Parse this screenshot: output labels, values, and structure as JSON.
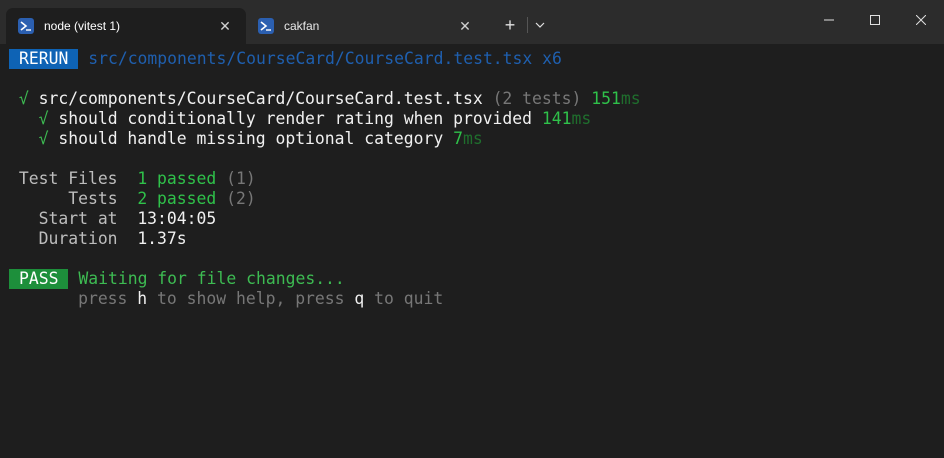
{
  "tabs": [
    {
      "title": "node (vitest 1)",
      "active": true,
      "icon": "powershell-icon"
    },
    {
      "title": "cakfan",
      "active": false,
      "icon": "powershell-icon"
    }
  ],
  "tabbar": {
    "new_tab": "+",
    "dropdown_icon": "chevron-down-icon"
  },
  "window": {
    "minimize_icon": "minimize-icon",
    "maximize_icon": "maximize-icon",
    "close_icon": "close-icon"
  },
  "terminal": {
    "rerun": {
      "badge": "RERUN",
      "file": "src/components/CourseCard/CourseCard.test.tsx",
      "count": "x6"
    },
    "suite": {
      "check": "√",
      "file": "src/components/CourseCard/CourseCard.test.tsx",
      "tests": "(2 tests)",
      "time": "151",
      "unit": "ms"
    },
    "tests": [
      {
        "check": "√",
        "name": "should conditionally render rating when provided",
        "time": "141",
        "unit": "ms"
      },
      {
        "check": "√",
        "name": "should handle missing optional category",
        "time": "7",
        "unit": "ms"
      }
    ],
    "summary": {
      "files_label": "Test Files",
      "files_value": "1 passed",
      "files_total": "(1)",
      "tests_label": "Tests",
      "tests_value": "2 passed",
      "tests_total": "(2)",
      "start_label": "Start at",
      "start_value": "13:04:05",
      "duration_label": "Duration",
      "duration_value": "1.37s"
    },
    "status": {
      "badge": "PASS",
      "message": "Waiting for file changes..."
    },
    "help": {
      "p1": "press ",
      "k1": "h",
      "p2": " to show help, press ",
      "k2": "q",
      "p3": " to quit"
    }
  },
  "colors": {
    "accent_blue": "#0e63b5",
    "pass_green": "#1d8f3b",
    "text_green": "#2fc14a"
  }
}
